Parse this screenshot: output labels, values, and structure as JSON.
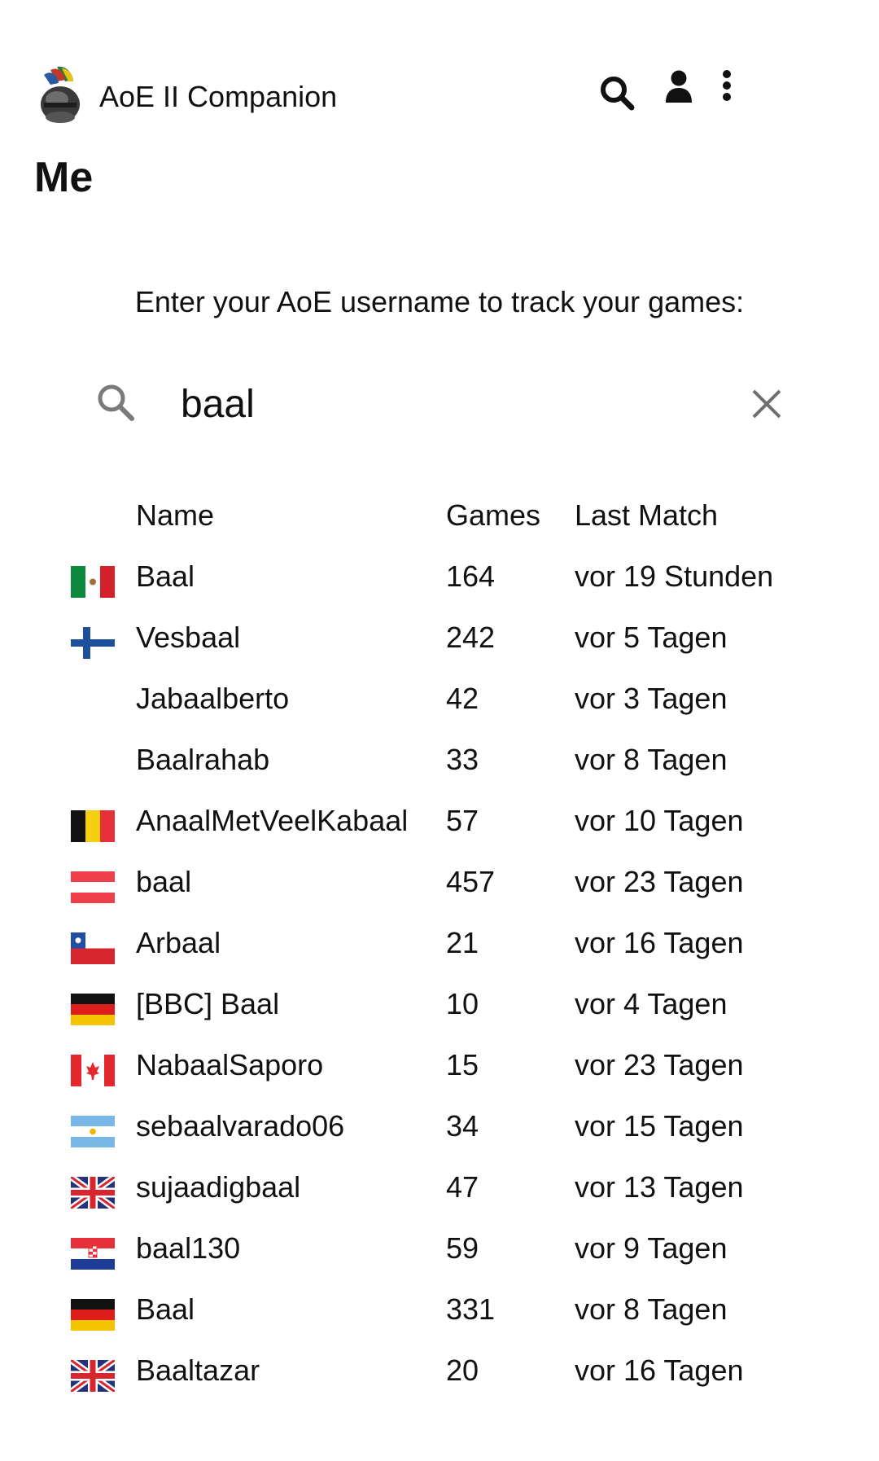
{
  "app": {
    "title": "AoE II Companion"
  },
  "page": {
    "title": "Me",
    "prompt": "Enter your AoE username to track your games:"
  },
  "search": {
    "value": "baal",
    "placeholder": ""
  },
  "table": {
    "headers": {
      "name": "Name",
      "games": "Games",
      "last_match": "Last Match"
    },
    "rows": [
      {
        "flag": "mexico-flag",
        "name": "Baal",
        "games": "164",
        "last_match": "vor 19 Stunden"
      },
      {
        "flag": "finland-flag",
        "name": "Vesbaal",
        "games": "242",
        "last_match": "vor 5 Tagen"
      },
      {
        "flag": "",
        "name": "Jabaalberto",
        "games": "42",
        "last_match": "vor 3 Tagen"
      },
      {
        "flag": "",
        "name": "Baalrahab",
        "games": "33",
        "last_match": "vor 8 Tagen"
      },
      {
        "flag": "belgium-flag",
        "name": "AnaalMetVeelKabaal",
        "games": "57",
        "last_match": "vor 10 Tagen"
      },
      {
        "flag": "austria-flag",
        "name": "baal",
        "games": "457",
        "last_match": "vor 23 Tagen"
      },
      {
        "flag": "chile-flag",
        "name": "Arbaal",
        "games": "21",
        "last_match": "vor 16 Tagen"
      },
      {
        "flag": "germany-flag",
        "name": "[BBC] Baal",
        "games": "10",
        "last_match": "vor 4 Tagen"
      },
      {
        "flag": "canada-flag",
        "name": "NabaalSaporo",
        "games": "15",
        "last_match": "vor 23 Tagen"
      },
      {
        "flag": "argentina-flag",
        "name": "sebaalvarado06",
        "games": "34",
        "last_match": "vor 15 Tagen"
      },
      {
        "flag": "uk-flag",
        "name": "sujaadigbaal",
        "games": "47",
        "last_match": "vor 13 Tagen"
      },
      {
        "flag": "croatia-flag",
        "name": "baal130",
        "games": "59",
        "last_match": "vor 9 Tagen"
      },
      {
        "flag": "germany-flag",
        "name": "Baal",
        "games": "331",
        "last_match": "vor 8 Tagen"
      },
      {
        "flag": "uk-flag",
        "name": "Baaltazar",
        "games": "20",
        "last_match": "vor 16 Tagen"
      }
    ]
  }
}
